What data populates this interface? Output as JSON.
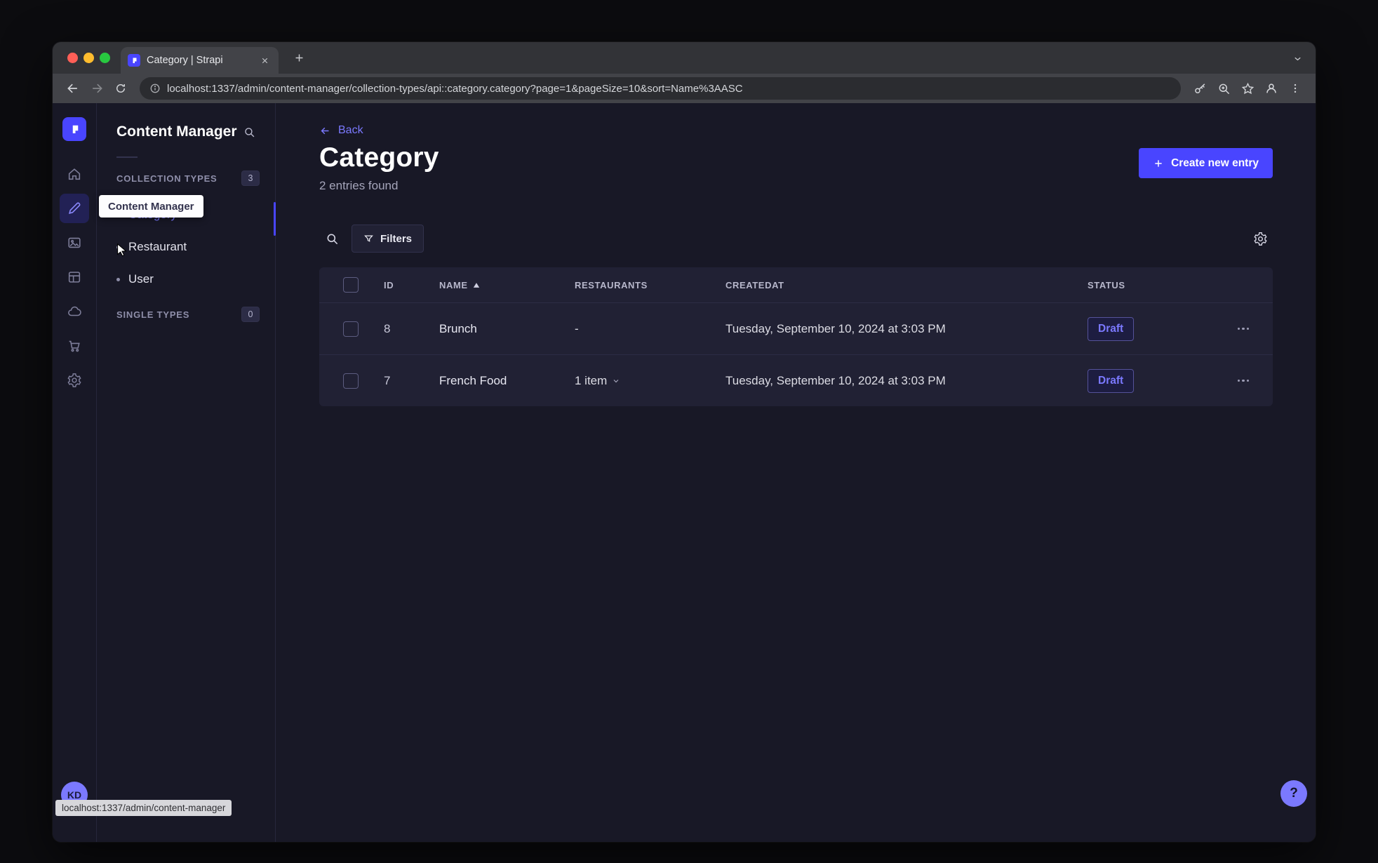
{
  "colors": {
    "accent": "#4945ff",
    "accent_light": "#7b79ff",
    "app_bg": "#181826",
    "panel_bg": "#212134"
  },
  "browser": {
    "tab": {
      "title": "Category | Strapi"
    },
    "address": {
      "url": "localhost:1337/admin/content-manager/collection-types/api::category.category?page=1&pageSize=10&sort=Name%3AASC"
    },
    "status_bubble": "localhost:1337/admin/content-manager"
  },
  "rail": {
    "icons": [
      "home-icon",
      "content-manager-icon",
      "media-library-icon",
      "content-type-builder-icon",
      "deploy-cloud-icon",
      "marketplace-cart-icon",
      "settings-gear-icon"
    ],
    "avatar_initials": "KD"
  },
  "subnav": {
    "title": "Content Manager",
    "sections": {
      "collection": {
        "label": "COLLECTION TYPES",
        "count": "3"
      },
      "single": {
        "label": "SINGLE TYPES",
        "count": "0"
      }
    },
    "items": [
      {
        "label": "Category"
      },
      {
        "label": "Restaurant"
      },
      {
        "label": "User"
      }
    ]
  },
  "tooltip": {
    "text": "Content Manager"
  },
  "main": {
    "back": "Back",
    "title": "Category",
    "subtitle": "2 entries found",
    "create_button": "Create new entry",
    "filters_button": "Filters",
    "help_label": "?",
    "table": {
      "headers": {
        "id": "ID",
        "name": "NAME",
        "restaurants": "RESTAURANTS",
        "createdat": "CREATEDAT",
        "status": "STATUS"
      },
      "rows": [
        {
          "id": "8",
          "name": "Brunch",
          "restaurants": "-",
          "createdat": "Tuesday, September 10, 2024 at 3:03 PM",
          "status": "Draft"
        },
        {
          "id": "7",
          "name": "French Food",
          "restaurants": "1 item",
          "createdat": "Tuesday, September 10, 2024 at 3:03 PM",
          "status": "Draft"
        }
      ]
    }
  }
}
